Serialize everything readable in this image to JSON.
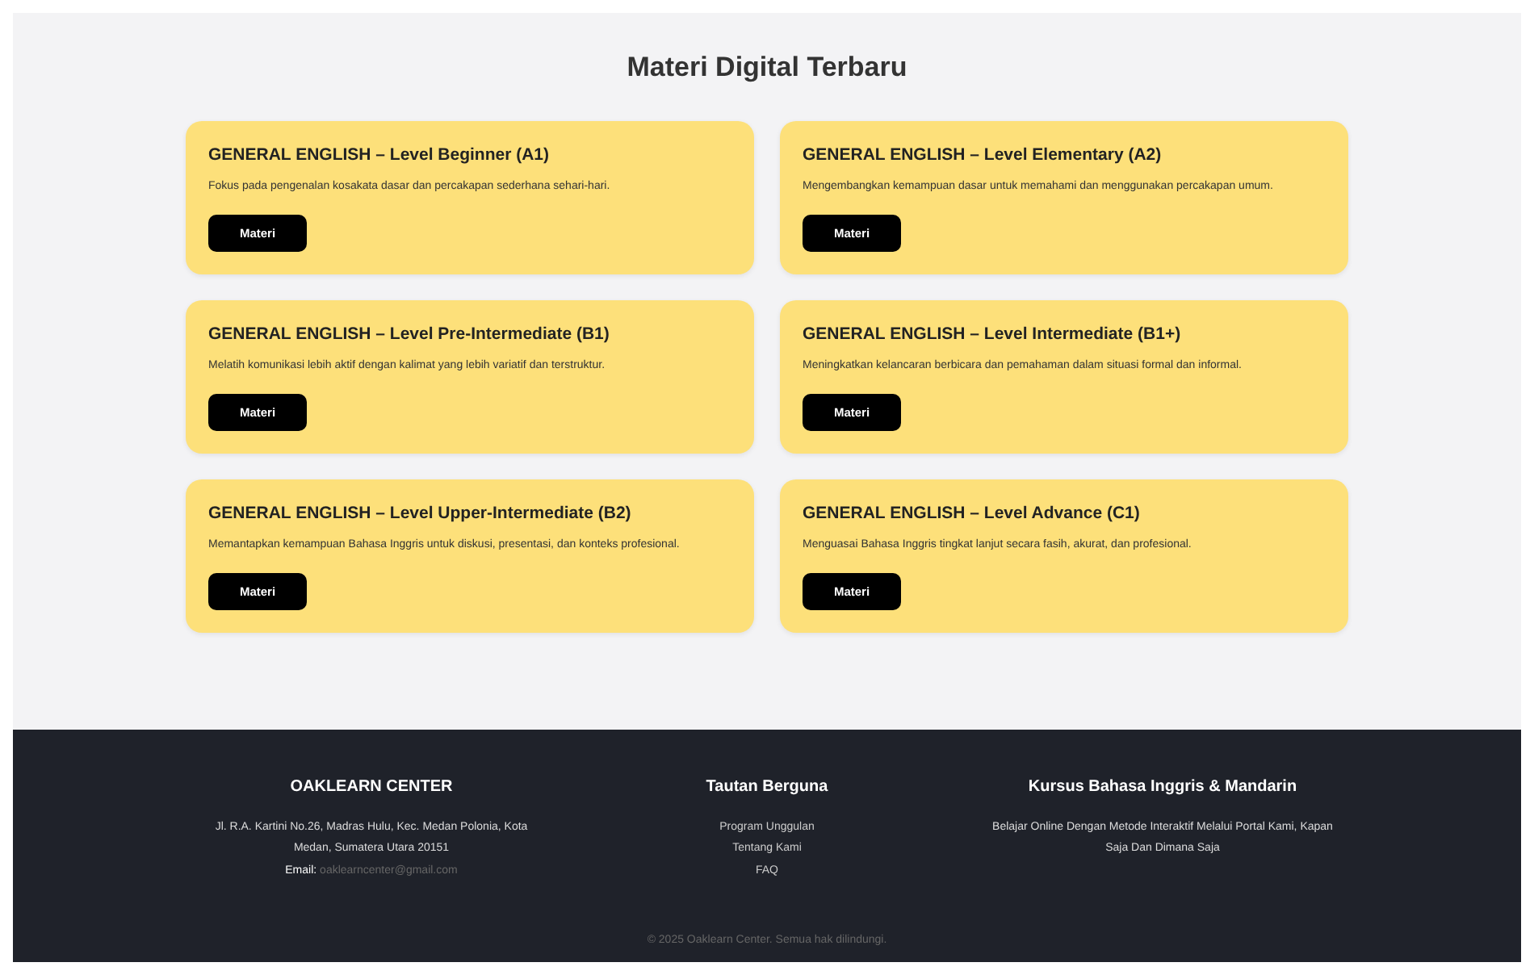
{
  "section_title": "Materi Digital Terbaru",
  "courses": [
    {
      "title": "GENERAL ENGLISH – Level Beginner (A1)",
      "description": "Fokus pada pengenalan kosakata dasar dan percakapan sederhana sehari-hari.",
      "button": "Materi"
    },
    {
      "title": "GENERAL ENGLISH – Level Elementary (A2)",
      "description": "Mengembangkan kemampuan dasar untuk memahami dan menggunakan percakapan umum.",
      "button": "Materi"
    },
    {
      "title": "GENERAL ENGLISH – Level Pre-Intermediate (B1)",
      "description": "Melatih komunikasi lebih aktif dengan kalimat yang lebih variatif dan terstruktur.",
      "button": "Materi"
    },
    {
      "title": "GENERAL ENGLISH – Level Intermediate (B1+)",
      "description": "Meningkatkan kelancaran berbicara dan pemahaman dalam situasi formal dan informal.",
      "button": "Materi"
    },
    {
      "title": "GENERAL ENGLISH – Level Upper-Intermediate (B2)",
      "description": "Memantapkan kemampuan Bahasa Inggris untuk diskusi, presentasi, dan konteks profesional.",
      "button": "Materi"
    },
    {
      "title": "GENERAL ENGLISH – Level Advance (C1)",
      "description": "Menguasai Bahasa Inggris tingkat lanjut secara fasih, akurat, dan profesional.",
      "button": "Materi"
    }
  ],
  "footer": {
    "about": {
      "title": "OAKLEARN CENTER",
      "address": "Jl. R.A. Kartini No.26, Madras Hulu, Kec. Medan Polonia, Kota Medan, Sumatera Utara 20151",
      "email_label": "Email:",
      "email": "oaklearncenter@gmail.com"
    },
    "links": {
      "title": "Tautan Berguna",
      "items": [
        "Program Unggulan",
        "Tentang Kami",
        "FAQ"
      ]
    },
    "courses": {
      "title": "Kursus Bahasa Inggris & Mandarin",
      "text": "Belajar Online Dengan Metode Interaktif Melalui Portal Kami, Kapan Saja Dan Dimana Saja"
    },
    "copyright": "© 2025 Oaklearn Center. Semua hak dilindungi."
  }
}
